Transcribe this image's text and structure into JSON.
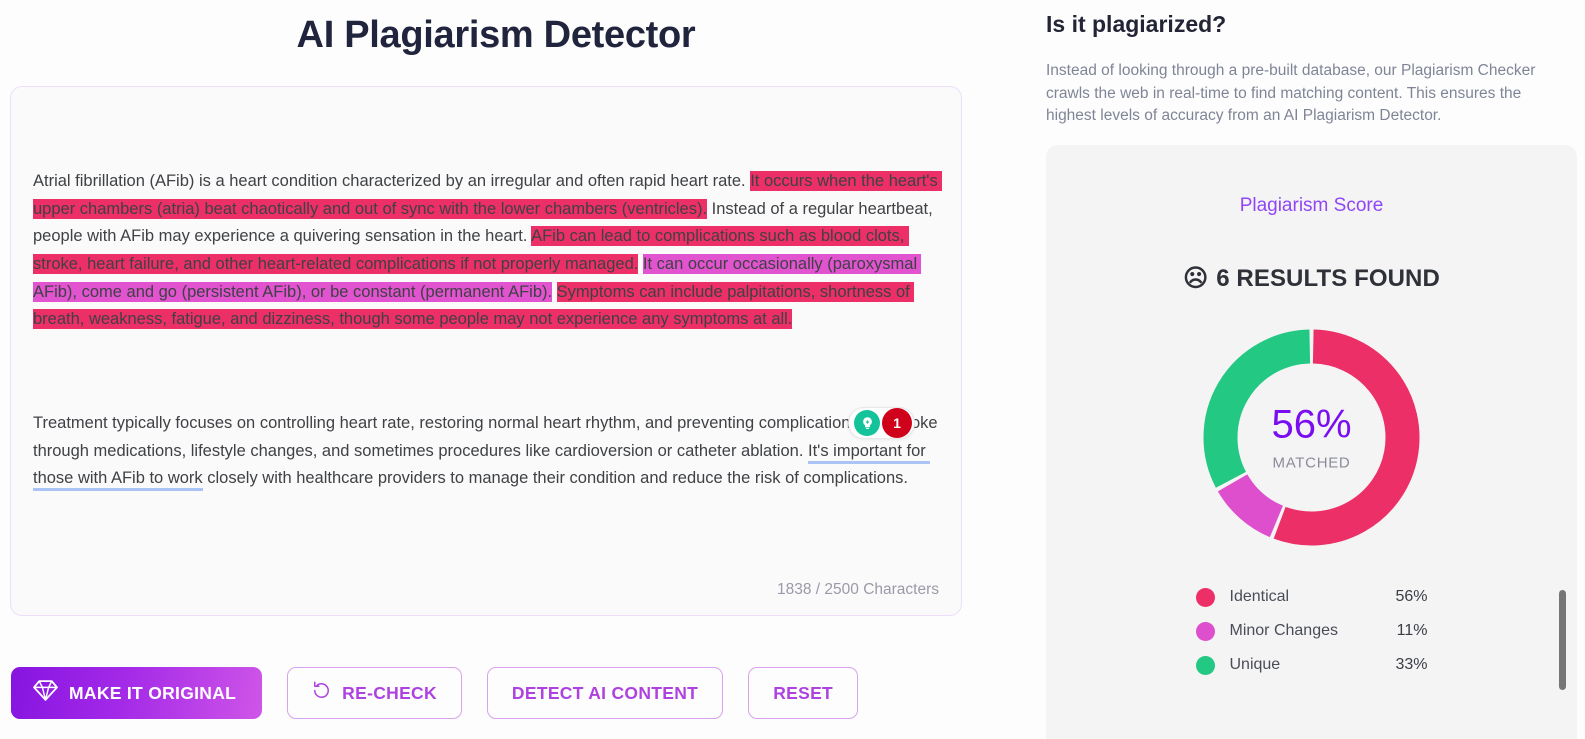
{
  "header": {
    "title": "AI Plagiarism Detector"
  },
  "editor": {
    "paragraph1": {
      "seg1": "Atrial fibrillation (AFib) is a heart condition characterized by an irregular and often rapid heart rate. ",
      "seg2_identical": "It occurs when the heart's upper chambers (atria) beat chaotically and out of sync with the lower chambers (ventricles).",
      "seg3": " Instead of a regular heartbeat, people with AFib may experience a quivering sensation in the heart. ",
      "seg4_identical": "AFib can lead to complications such as blood clots, stroke, heart failure, and other heart-related complications if not properly managed.",
      "seg5": " ",
      "seg6_minor": "It can occur occasionally (paroxysmal AFib), come and go (persistent AFib), or be constant (permanent AFib).",
      "seg7": " ",
      "seg8_identical": "Symptoms can include palpitations, shortness of breath, weakness, fatigue, and dizziness, though some people may not experience any symptoms at all."
    },
    "paragraph2": {
      "seg1": "Treatment typically focuses on controlling heart rate, restoring normal heart rhythm, and preventing complications like stroke through medications, lifestyle changes, and sometimes procedures like cardioversion or catheter ablation. ",
      "seg2_underlined": "It's important for those with AFib to work",
      "seg3": " closely with healthcare providers to manage their condition and reduce the risk of complications."
    },
    "grammar_widget": {
      "bulb_icon": "lightbulb-icon",
      "count": "1"
    },
    "character_counter": "1838 / 2500 Characters"
  },
  "buttons": {
    "make_it_original": "MAKE IT ORIGINAL",
    "make_it_original_icon": "diamond-icon",
    "re_check": "RE-CHECK",
    "re_check_icon": "refresh-icon",
    "detect_ai_content": "DETECT AI CONTENT",
    "reset": "RESET"
  },
  "sidebar": {
    "title": "Is it plagiarized?",
    "description": "Instead of looking through a pre-built database, our Plagiarism Checker crawls the web in real-time to find matching content. This ensures the highest levels of accuracy from an AI Plagiarism Detector.",
    "score_card": {
      "label": "Plagiarism Score",
      "results_icon": "sad-face-icon",
      "results_text": "6 RESULTS FOUND",
      "center_percent": "56%",
      "center_sub": "MATCHED"
    }
  },
  "chart_data": {
    "type": "pie",
    "title": "Plagiarism Score",
    "center_label": "56%",
    "center_sublabel": "MATCHED",
    "categories": [
      "Identical",
      "Minor Changes",
      "Unique"
    ],
    "values": [
      56,
      11,
      33
    ],
    "value_labels": [
      "56%",
      "11%",
      "33%"
    ],
    "colors": [
      "#ed2f67",
      "#dd4fcc",
      "#23c882"
    ],
    "legend_position": "bottom",
    "donut": true,
    "start_angle_deg": 0,
    "direction": "clockwise"
  },
  "colors": {
    "accent_purple": "#9046f5",
    "identical": "#ed2f67",
    "minor_changes": "#dd4fcc",
    "unique": "#23c882",
    "score_text": "#7a0ef0"
  }
}
